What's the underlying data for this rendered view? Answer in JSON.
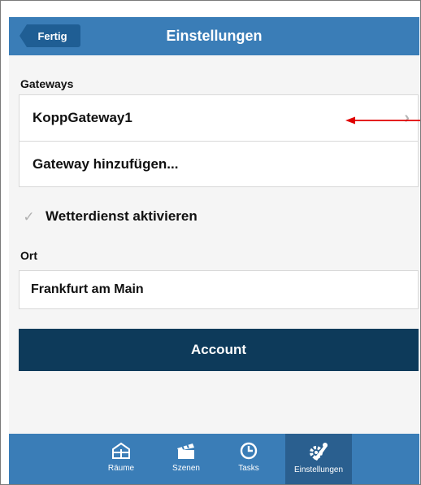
{
  "header": {
    "back_label": "Fertig",
    "title": "Einstellungen",
    "color": "#3a7db7"
  },
  "gateways": {
    "section_label": "Gateways",
    "items": [
      {
        "label": "KoppGateway1",
        "icon": "chevron-right-icon"
      },
      {
        "label": "Gateway hinzufügen..."
      }
    ]
  },
  "weather": {
    "label": "Wetterdienst aktivieren",
    "checked": true
  },
  "location": {
    "section_label": "Ort",
    "value": "Frankfurt am Main"
  },
  "account": {
    "label": "Account",
    "color": "#0d3a5a"
  },
  "tabbar": {
    "tabs": [
      {
        "label": "Räume",
        "icon": "house-grid-icon"
      },
      {
        "label": "Szenen",
        "icon": "clapperboard-icon"
      },
      {
        "label": "Tasks",
        "icon": "clock-icon"
      },
      {
        "label": "Einstellungen",
        "icon": "wrench-gear-icon",
        "active": true
      }
    ]
  },
  "annotation": {
    "type": "arrow",
    "color": "#e00000"
  }
}
